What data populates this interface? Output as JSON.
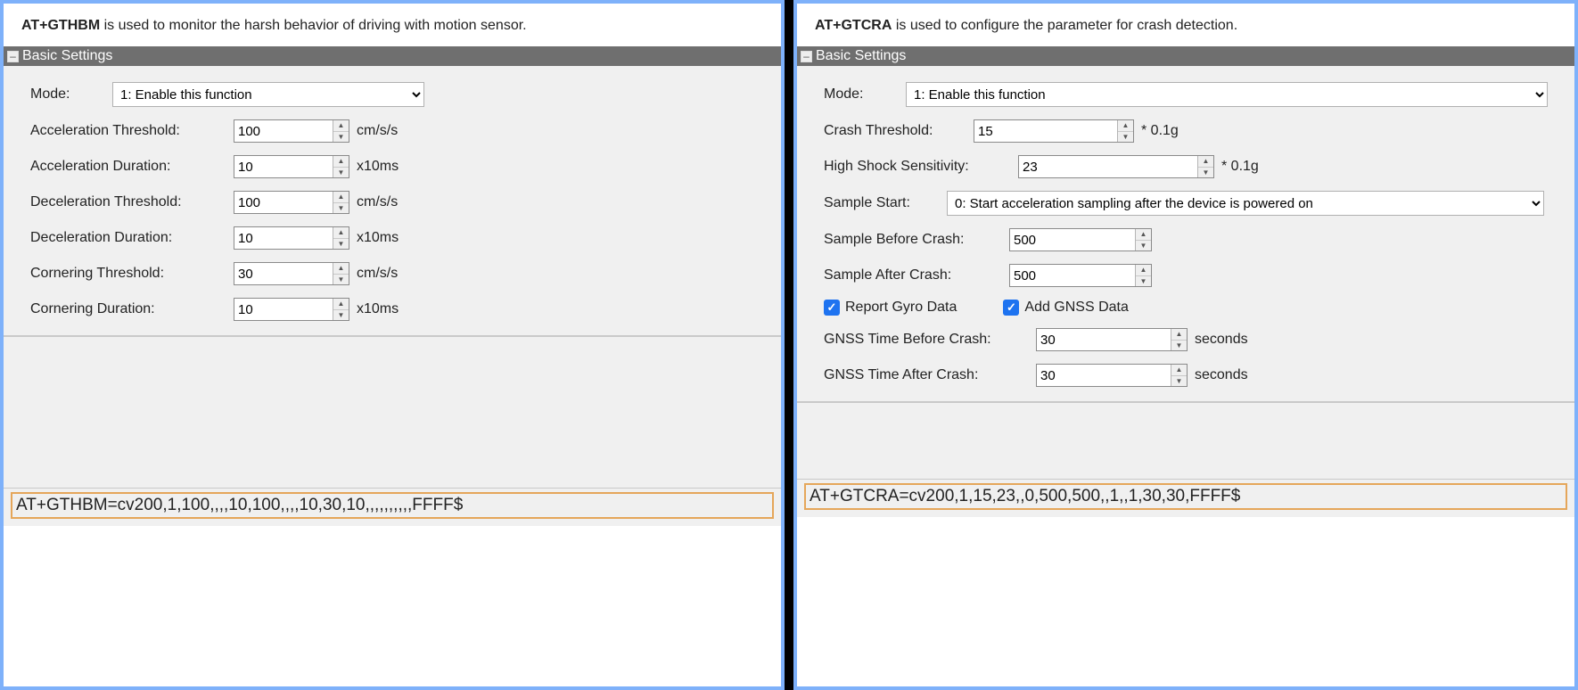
{
  "left": {
    "cmd": "AT+GTHBM",
    "desc": " is used to monitor the harsh behavior of driving with motion sensor.",
    "section_title": "Basic Settings",
    "mode_label": "Mode:",
    "mode_value": "1: Enable this function",
    "fields": [
      {
        "label": "Acceleration Threshold:",
        "value": "100",
        "unit": "cm/s/s"
      },
      {
        "label": "Acceleration Duration:",
        "value": "10",
        "unit": "x10ms"
      },
      {
        "label": "Deceleration  Threshold:",
        "value": "100",
        "unit": "cm/s/s"
      },
      {
        "label": "Deceleration Duration:",
        "value": "10",
        "unit": "x10ms"
      },
      {
        "label": "Cornering Threshold:",
        "value": "30",
        "unit": "cm/s/s"
      },
      {
        "label": "Cornering Duration:",
        "value": "10",
        "unit": "x10ms"
      }
    ],
    "cmdline": "AT+GTHBM=cv200,1,100,,,,10,100,,,,10,30,10,,,,,,,,,,FFFF$"
  },
  "right": {
    "cmd": "AT+GTCRA",
    "desc": "  is used to configure the parameter for crash detection.",
    "section_title": "Basic Settings",
    "mode_label": "Mode:",
    "mode_value": "1: Enable this function",
    "crash_threshold_label": "Crash Threshold:",
    "crash_threshold_value": "15",
    "crash_threshold_unit": "* 0.1g",
    "high_shock_label": "High Shock Sensitivity:",
    "high_shock_value": "23",
    "high_shock_unit": "* 0.1g",
    "sample_start_label": "Sample Start:",
    "sample_start_value": "0: Start acceleration sampling after the device is powered on",
    "sample_before_label": "Sample Before Crash:",
    "sample_before_value": "500",
    "sample_after_label": "Sample After Crash:",
    "sample_after_value": "500",
    "report_gyro_label": "Report Gyro Data",
    "add_gnss_label": "Add GNSS Data",
    "gnss_before_label": "GNSS Time Before Crash:",
    "gnss_before_value": "30",
    "gnss_before_unit": "seconds",
    "gnss_after_label": "GNSS Time After Crash:",
    "gnss_after_value": "30",
    "gnss_after_unit": "seconds",
    "cmdline": "AT+GTCRA=cv200,1,15,23,,0,500,500,,1,,1,30,30,FFFF$"
  }
}
